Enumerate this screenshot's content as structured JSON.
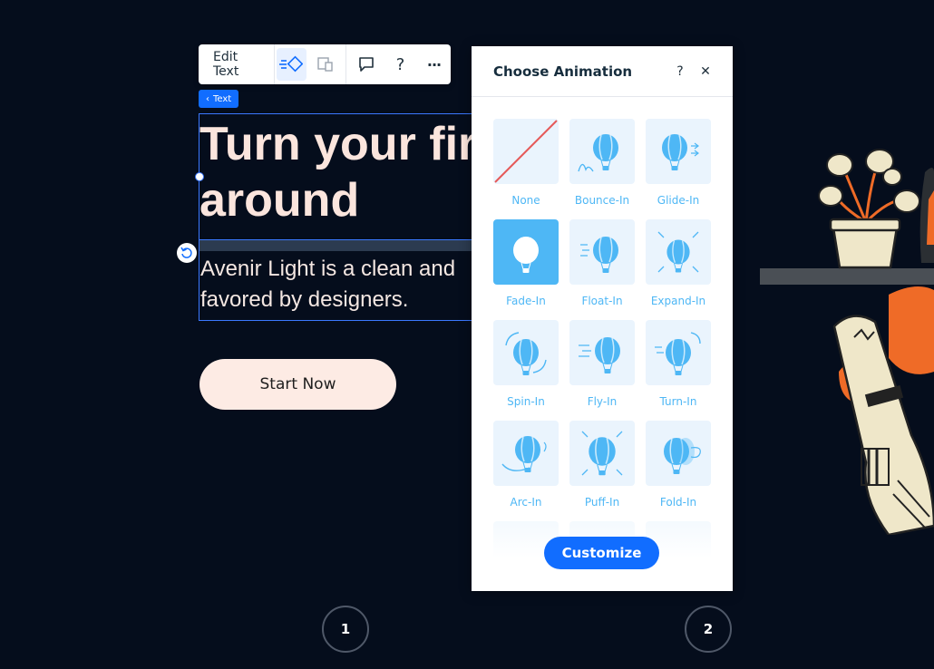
{
  "toolbar": {
    "edit_text_label": "Edit Text",
    "icons": [
      "animation-icon",
      "layout-icon",
      "comment-icon",
      "help-icon",
      "more-icon"
    ],
    "help_glyph": "?",
    "more_glyph": "···"
  },
  "text_tag": {
    "label": "Text"
  },
  "hero": {
    "title_line1": "Turn your fir",
    "title_line2": "around",
    "para_line1": "Avenir Light is a clean and",
    "para_line2": "favored by designers.",
    "cta_label": "Start Now"
  },
  "pagination": {
    "page1": "1",
    "page2": "2"
  },
  "panel": {
    "title": "Choose Animation",
    "help_glyph": "?",
    "close_glyph": "✕",
    "animations": [
      {
        "label": "None",
        "icon": "none-icon"
      },
      {
        "label": "Bounce-In",
        "icon": "bounce-in-icon"
      },
      {
        "label": "Glide-In",
        "icon": "glide-in-icon"
      },
      {
        "label": "Fade-In",
        "icon": "fade-in-icon",
        "selected": true
      },
      {
        "label": "Float-In",
        "icon": "float-in-icon"
      },
      {
        "label": "Expand-In",
        "icon": "expand-in-icon"
      },
      {
        "label": "Spin-In",
        "icon": "spin-in-icon"
      },
      {
        "label": "Fly-In",
        "icon": "fly-in-icon"
      },
      {
        "label": "Turn-In",
        "icon": "turn-in-icon"
      },
      {
        "label": "Arc-In",
        "icon": "arc-in-icon"
      },
      {
        "label": "Puff-In",
        "icon": "puff-in-icon"
      },
      {
        "label": "Fold-In",
        "icon": "fold-in-icon"
      }
    ],
    "customize_label": "Customize"
  },
  "colors": {
    "background": "#050d1c",
    "accent": "#116dff",
    "tile_label": "#4eb7f5",
    "hero_text": "#fbe5dd",
    "cta_bg": "#fdebe4"
  }
}
